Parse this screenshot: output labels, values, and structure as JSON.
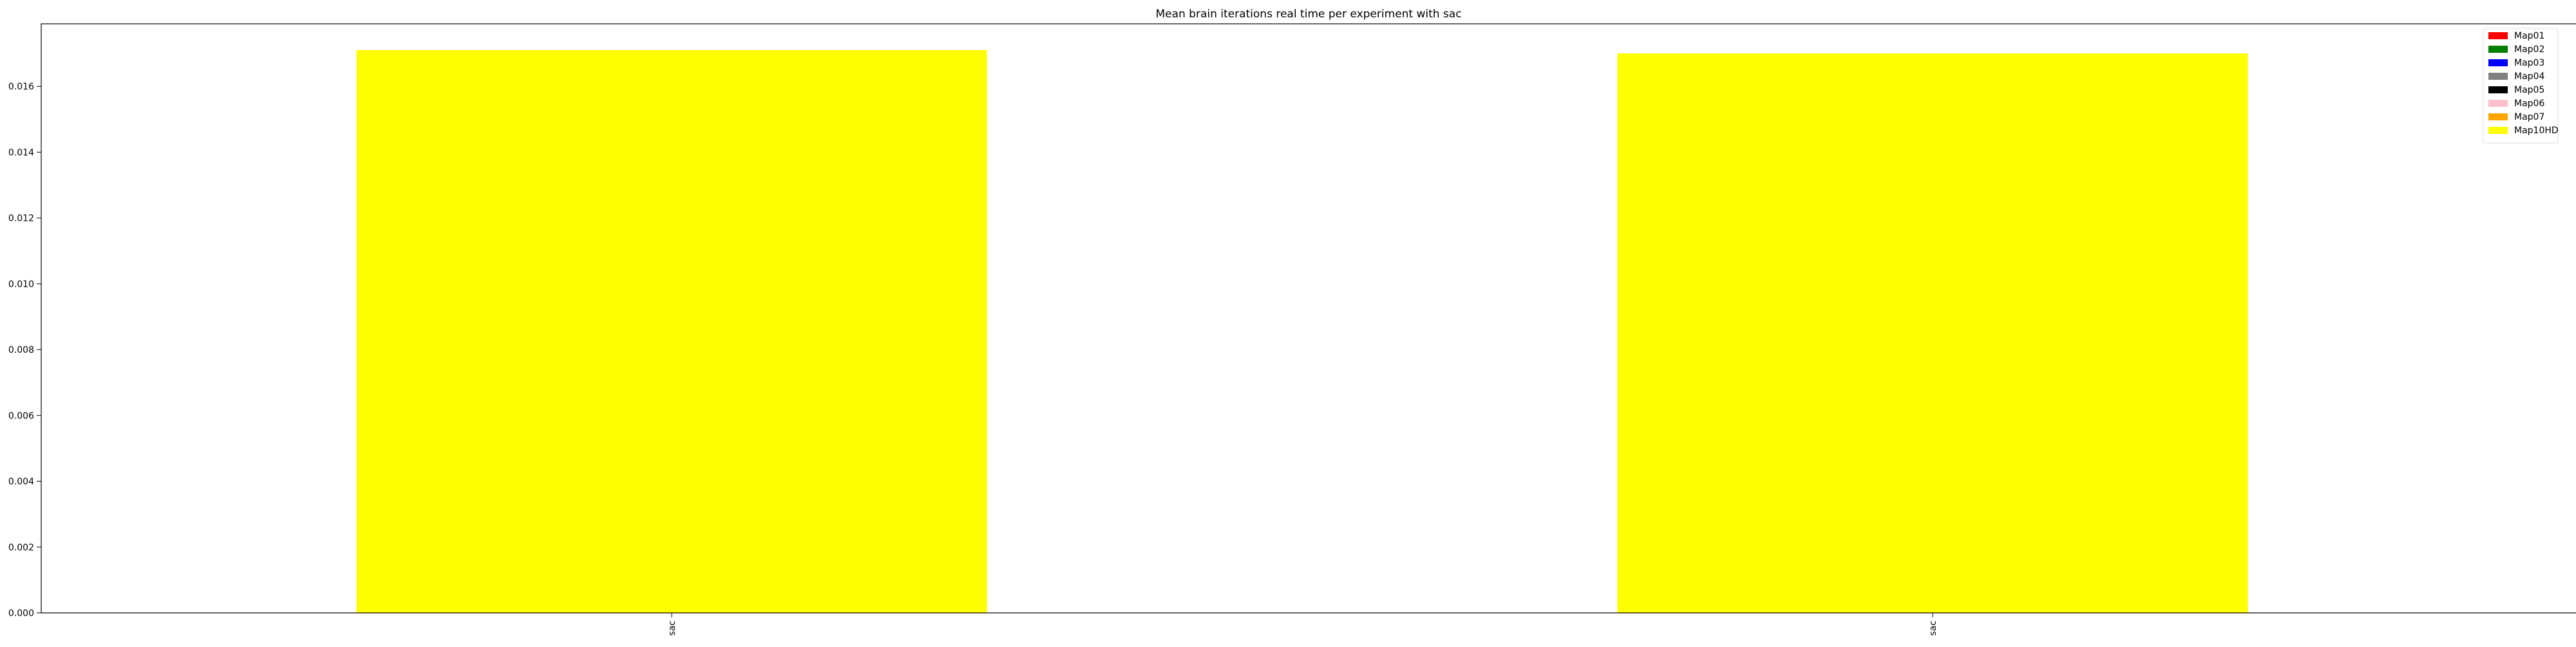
{
  "chart_data": {
    "type": "bar",
    "title": "Mean brain iterations real time per experiment with sac",
    "xlabel": "",
    "ylabel": "",
    "categories": [
      "sac",
      "sac"
    ],
    "series": [
      {
        "name": "Map01",
        "color": "#ff0000",
        "values": [
          0,
          0
        ]
      },
      {
        "name": "Map02",
        "color": "#008000",
        "values": [
          0,
          0
        ]
      },
      {
        "name": "Map03",
        "color": "#0000ff",
        "values": [
          0,
          0
        ]
      },
      {
        "name": "Map04",
        "color": "#808080",
        "values": [
          0,
          0
        ]
      },
      {
        "name": "Map05",
        "color": "#000000",
        "values": [
          0,
          0
        ]
      },
      {
        "name": "Map06",
        "color": "#ffc0cb",
        "values": [
          0,
          0
        ]
      },
      {
        "name": "Map07",
        "color": "#ffa500",
        "values": [
          0,
          0
        ]
      },
      {
        "name": "Map10HD",
        "color": "#ffff00",
        "values": [
          0.0171,
          0.017
        ]
      }
    ],
    "ylim": [
      0,
      0.0179
    ],
    "yticks": [
      0,
      0.002,
      0.004,
      0.006,
      0.008,
      0.01,
      0.012,
      0.014,
      0.016
    ],
    "ytick_labels": [
      "0.000",
      "0.002",
      "0.004",
      "0.006",
      "0.008",
      "0.010",
      "0.012",
      "0.014",
      "0.016"
    ],
    "grid": false,
    "legend_position": "top-right"
  }
}
